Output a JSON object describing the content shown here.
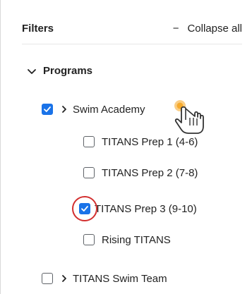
{
  "header": {
    "title": "Filters",
    "collapse_label": "Collapse all",
    "collapse_symbol": "−"
  },
  "group": {
    "label": "Programs"
  },
  "items": [
    {
      "label": "Swim Academy",
      "checked": true,
      "expandable": true,
      "level": 1
    },
    {
      "label": "TITANS Prep 1 (4-6)",
      "checked": false,
      "expandable": false,
      "level": 2
    },
    {
      "label": "TITANS Prep 2 (7-8)",
      "checked": false,
      "expandable": false,
      "level": 2
    },
    {
      "label": "TITANS Prep 3 (9-10)",
      "checked": true,
      "expandable": false,
      "level": 2
    },
    {
      "label": "Rising TITANS",
      "checked": false,
      "expandable": false,
      "level": 2
    },
    {
      "label": "TITANS Swim Team",
      "checked": false,
      "expandable": true,
      "level": 1
    }
  ],
  "colors": {
    "accent": "#1a73e8",
    "highlight": "#d32f2f",
    "cursor_glow": "#f5a623"
  }
}
